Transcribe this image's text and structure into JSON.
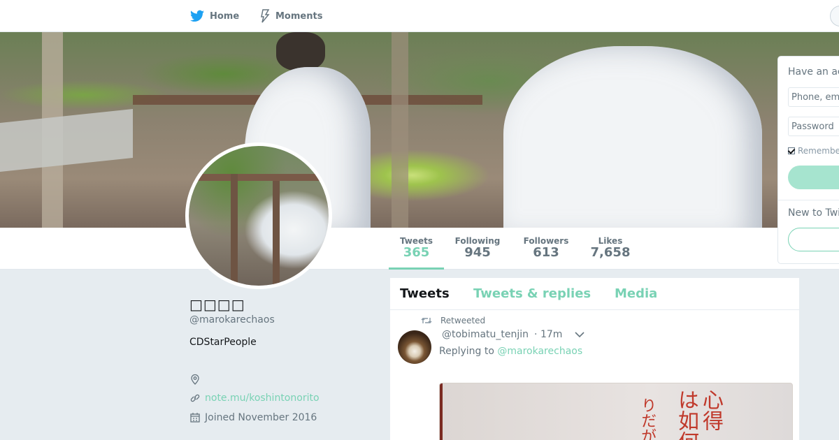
{
  "nav": {
    "home_label": "Home",
    "moments_label": "Moments"
  },
  "profile": {
    "name": "□□□□",
    "handle": "@marokarechaos",
    "bio": "CDStarPeople",
    "location": "",
    "url": "note.mu/koshintonorito",
    "joined": "Joined November 2016"
  },
  "stats": [
    {
      "label": "Tweets",
      "value": "365",
      "active": true
    },
    {
      "label": "Following",
      "value": "945",
      "active": false
    },
    {
      "label": "Followers",
      "value": "613",
      "active": false
    },
    {
      "label": "Likes",
      "value": "7,658",
      "active": false
    }
  ],
  "timeline": {
    "tabs": [
      "Tweets",
      "Tweets & replies",
      "Media"
    ],
    "active_tab": "Tweets",
    "tweet": {
      "retweet_label": "Retweeted",
      "author_handle": "@tobimatu_tenjin",
      "time": "· 17m",
      "reply_prefix": "Replying to",
      "reply_to": "@marokarechaos"
    }
  },
  "login": {
    "have_account": "Have an ac",
    "phone_placeholder": "Phone, em",
    "password_placeholder": "Password",
    "remember": "Remembe",
    "new_to": "New to Twi"
  },
  "colors": {
    "accent": "#79d2b4",
    "text_secondary": "#66757f",
    "background": "#e6ecf0"
  },
  "icons": [
    "twitter-bird-icon",
    "lightning-icon",
    "location-icon",
    "link-icon",
    "calendar-icon",
    "retweet-icon",
    "chevron-down-icon"
  ]
}
